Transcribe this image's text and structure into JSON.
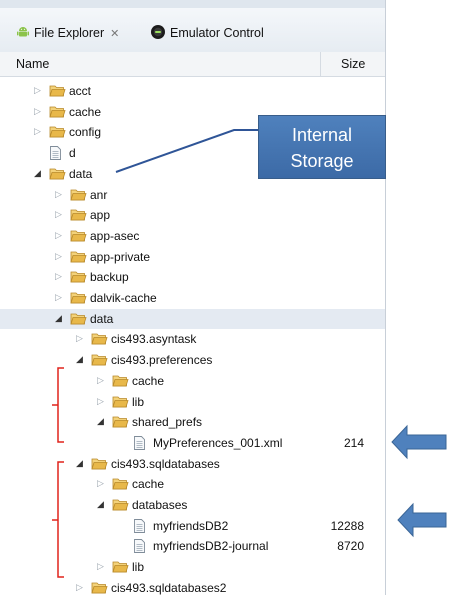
{
  "tabs": {
    "file_explorer": "File Explorer",
    "file_explorer_close": "✕",
    "emulator_control": "Emulator Control"
  },
  "columns": {
    "name": "Name",
    "size": "Size"
  },
  "tree": [
    {
      "label": "acct",
      "type": "folder",
      "expand": "closed",
      "indent": 0,
      "size": ""
    },
    {
      "label": "cache",
      "type": "folder",
      "expand": "closed",
      "indent": 0,
      "size": ""
    },
    {
      "label": "config",
      "type": "folder",
      "expand": "closed",
      "indent": 0,
      "size": ""
    },
    {
      "label": "d",
      "type": "file",
      "expand": "none",
      "indent": 0,
      "size": ""
    },
    {
      "label": "data",
      "type": "folder",
      "expand": "open",
      "indent": 0,
      "size": ""
    },
    {
      "label": "anr",
      "type": "folder",
      "expand": "closed",
      "indent": 1,
      "size": ""
    },
    {
      "label": "app",
      "type": "folder",
      "expand": "closed",
      "indent": 1,
      "size": ""
    },
    {
      "label": "app-asec",
      "type": "folder",
      "expand": "closed",
      "indent": 1,
      "size": ""
    },
    {
      "label": "app-private",
      "type": "folder",
      "expand": "closed",
      "indent": 1,
      "size": ""
    },
    {
      "label": "backup",
      "type": "folder",
      "expand": "closed",
      "indent": 1,
      "size": ""
    },
    {
      "label": "dalvik-cache",
      "type": "folder",
      "expand": "closed",
      "indent": 1,
      "size": ""
    },
    {
      "label": "data",
      "type": "folder",
      "expand": "open",
      "indent": 1,
      "size": "",
      "selected": true
    },
    {
      "label": "cis493.asyntask",
      "type": "folder",
      "expand": "closed",
      "indent": 2,
      "size": ""
    },
    {
      "label": "cis493.preferences",
      "type": "folder",
      "expand": "open",
      "indent": 2,
      "size": ""
    },
    {
      "label": "cache",
      "type": "folder",
      "expand": "closed",
      "indent": 3,
      "size": ""
    },
    {
      "label": "lib",
      "type": "folder",
      "expand": "closed",
      "indent": 3,
      "size": ""
    },
    {
      "label": "shared_prefs",
      "type": "folder",
      "expand": "open",
      "indent": 3,
      "size": ""
    },
    {
      "label": "MyPreferences_001.xml",
      "type": "file",
      "expand": "none",
      "indent": 4,
      "size": "214"
    },
    {
      "label": "cis493.sqldatabases",
      "type": "folder",
      "expand": "open",
      "indent": 2,
      "size": ""
    },
    {
      "label": "cache",
      "type": "folder",
      "expand": "closed",
      "indent": 3,
      "size": ""
    },
    {
      "label": "databases",
      "type": "folder",
      "expand": "open",
      "indent": 3,
      "size": ""
    },
    {
      "label": "myfriendsDB2",
      "type": "file",
      "expand": "none",
      "indent": 4,
      "size": "12288"
    },
    {
      "label": "myfriendsDB2-journal",
      "type": "file",
      "expand": "none",
      "indent": 4,
      "size": "8720"
    },
    {
      "label": "lib",
      "type": "folder",
      "expand": "closed",
      "indent": 3,
      "size": ""
    },
    {
      "label": "cis493.sqldatabases2",
      "type": "folder",
      "expand": "closed",
      "indent": 2,
      "size": ""
    }
  ],
  "callout": {
    "line1": "Internal",
    "line2": "Storage"
  },
  "colors": {
    "callout": "#4f81bd",
    "bracket": "#e0231c",
    "arrow": "#4f81bd",
    "folder": "#e8b84a",
    "selection": "#e4eaf2"
  }
}
